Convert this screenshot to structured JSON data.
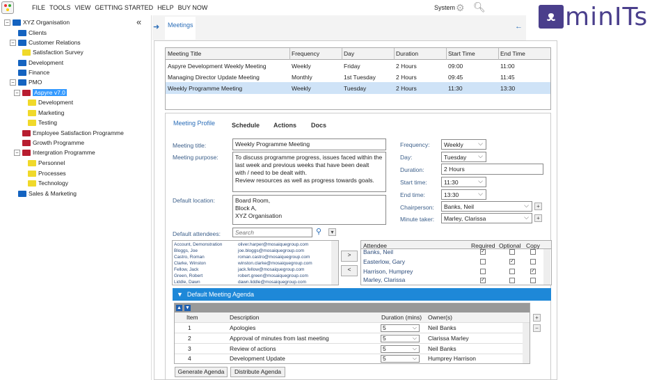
{
  "menu": {
    "items": [
      "FILE",
      "TOOLS",
      "VIEW",
      "GETTING STARTED",
      "HELP",
      "BUY NOW"
    ],
    "system_label": "System"
  },
  "logo": {
    "text": "minITs"
  },
  "tree": [
    {
      "label": "XYZ Organisation",
      "color": "blue",
      "toggle": "−"
    },
    {
      "label": "Clients",
      "color": "blue"
    },
    {
      "label": "Customer Relations",
      "color": "blue",
      "toggle": "−"
    },
    {
      "label": "Satisfaction Survey",
      "color": "yellow"
    },
    {
      "label": "Development",
      "color": "blue"
    },
    {
      "label": "Finance",
      "color": "blue"
    },
    {
      "label": "PMO",
      "color": "blue",
      "toggle": "−"
    },
    {
      "label": "Aspyre v7.0",
      "color": "red",
      "toggle": "−",
      "selected": true
    },
    {
      "label": "Development",
      "color": "yellow"
    },
    {
      "label": "Marketing",
      "color": "yellow"
    },
    {
      "label": "Testing",
      "color": "yellow"
    },
    {
      "label": "Employee Satisfaction Programme",
      "color": "red"
    },
    {
      "label": "Growth Programme",
      "color": "red"
    },
    {
      "label": "Intergration Programme",
      "color": "red",
      "toggle": "−"
    },
    {
      "label": "Personnel",
      "color": "yellow"
    },
    {
      "label": "Processes",
      "color": "yellow"
    },
    {
      "label": "Technology",
      "color": "yellow"
    },
    {
      "label": "Sales & Marketing",
      "color": "blue"
    }
  ],
  "tab": {
    "label": "Meetings"
  },
  "meetings": {
    "columns": [
      "Meeting Title",
      "Frequency",
      "Day",
      "Duration",
      "Start Time",
      "End Time"
    ],
    "rows": [
      [
        "Aspyre Development Weekly Meeting",
        "Weekly",
        "Friday",
        "2 Hours",
        "09:00",
        "11:00"
      ],
      [
        "Managing Director Update Meeting",
        "Monthly",
        "1st Tuesday",
        "2 Hours",
        "09:45",
        "11:45"
      ],
      [
        "Weekly Programme Meeting",
        "Weekly",
        "Tuesday",
        "2 Hours",
        "11:30",
        "13:30"
      ]
    ]
  },
  "detail_tabs": [
    "Meeting Profile",
    "Schedule",
    "Actions",
    "Docs"
  ],
  "form": {
    "title_label": "Meeting title:",
    "title_value": "Weekly Programme Meeting",
    "purpose_label": "Meeting purpose:",
    "purpose_lines": [
      "To discuss programme progress, issues faced within the",
      "last week and previous weeks that have been dealt",
      "with / need to be dealt with.",
      "Review resources as well as progress towards goals."
    ],
    "location_label": "Default location:",
    "location_lines": [
      "Board Room,",
      "Block A,",
      "XYZ Organisation"
    ],
    "attendees_label": "Default attendees:",
    "search_placeholder": "Search",
    "frequency_label": "Frequency:",
    "frequency_value": "Weekly",
    "day_label": "Day:",
    "day_value": "Tuesday",
    "duration_label": "Duration:",
    "duration_value": "2 Hours",
    "start_label": "Start time:",
    "start_value": "11:30",
    "end_label": "End time:",
    "end_value": "13:30",
    "chair_label": "Chairperson:",
    "chair_value": "Banks, Neil",
    "minute_label": "Minute taker:",
    "minute_value": "Marley, Clarissa"
  },
  "people": [
    [
      "Account, Demonstration",
      "oliver.harper@mosaiquegroup.com"
    ],
    [
      "Bloggs, Joe",
      "joe.bloggs@mosaiquegroup.com"
    ],
    [
      "Castro, Roman",
      "roman.castro@mosaiquegroup.com"
    ],
    [
      "Clarke, Winston",
      "winston.clarke@mosaiquegroup.com"
    ],
    [
      "Fellow, Jack",
      "jack.fellow@mosaiquegroup.com"
    ],
    [
      "Green, Robert",
      "robert.green@mosaiquegroup.com"
    ],
    [
      "Liddle, Dawn",
      "dawn.liddle@mosaiquegroup.com"
    ]
  ],
  "move_right": ">",
  "move_left": "<",
  "attendee_grid": {
    "columns": [
      "Attendee",
      "Required",
      "Optional",
      "Copy"
    ],
    "rows": [
      {
        "name": "Banks, Neil",
        "req": true,
        "opt": false,
        "copy": false
      },
      {
        "name": "Easterlow, Gary",
        "req": false,
        "opt": true,
        "copy": false
      },
      {
        "name": "Harrison, Humprey",
        "req": false,
        "opt": false,
        "copy": true
      },
      {
        "name": "Marley, Clarissa",
        "req": true,
        "opt": false,
        "copy": false
      }
    ]
  },
  "agenda": {
    "header": "Default Meeting Agenda",
    "columns": [
      "Item",
      "Description",
      "Duration (mins)",
      "Owner(s)"
    ],
    "rows": [
      [
        "1",
        "Apologies",
        "5",
        "Neil Banks"
      ],
      [
        "2",
        "Approval of minutes from last meeting",
        "5",
        "Clarissa Marley"
      ],
      [
        "3",
        "Review of actions",
        "5",
        "Neil Banks"
      ],
      [
        "4",
        "Development Update",
        "5",
        "Humprey Harrison"
      ]
    ],
    "generate_label": "Generate Agenda",
    "distribute_label": "Distribute Agenda"
  }
}
